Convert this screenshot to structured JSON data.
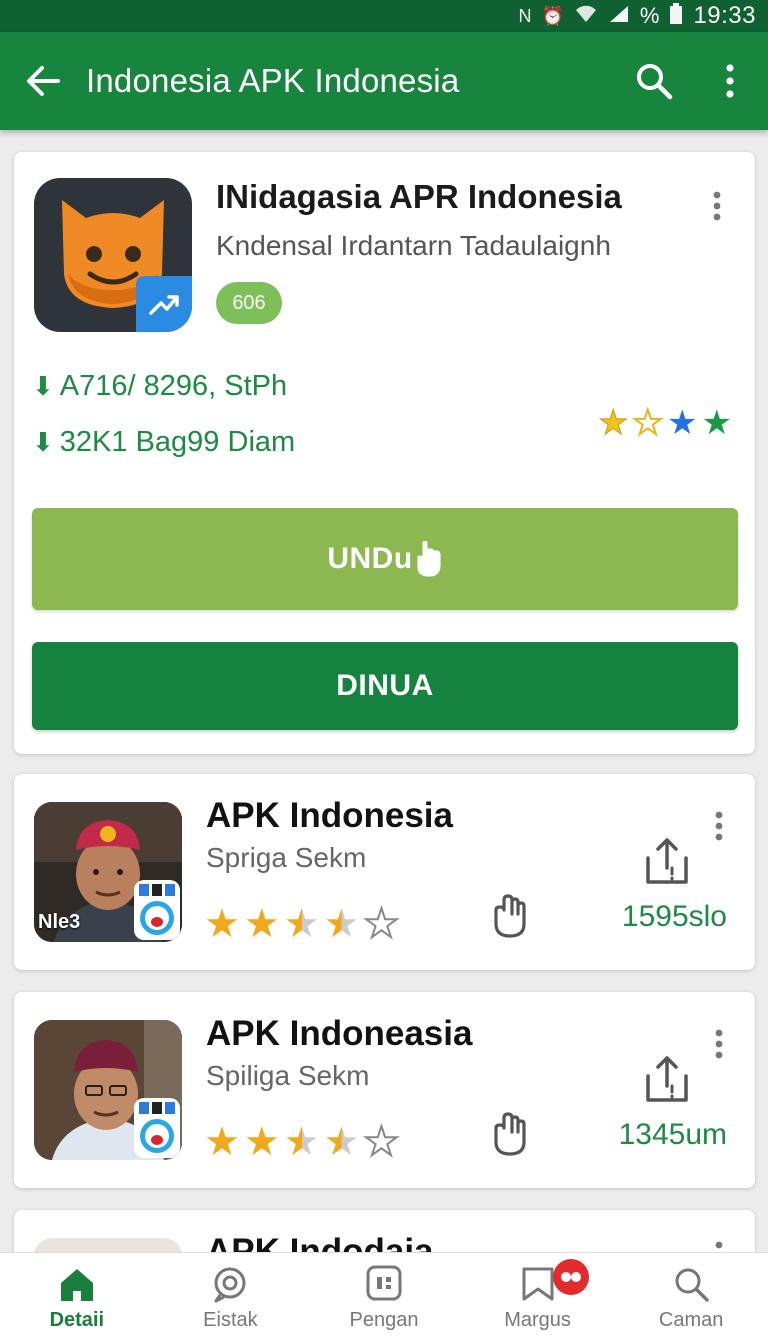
{
  "status_bar": {
    "time": "19:33",
    "battery_text": "%",
    "icons": [
      "nfc-icon",
      "alarm-icon",
      "wifi-icon",
      "signal-icon",
      "battery-icon"
    ]
  },
  "app_bar": {
    "title": "Indonesia  APK Indonesia",
    "icons": [
      "back-arrow-icon",
      "search-icon",
      "more-vert-icon"
    ]
  },
  "main_card": {
    "app_name": "INidagasia APR Indonesia",
    "developer": "Kndensal Irdantarn Tadaulaignh",
    "badge": "606",
    "stat_1": "A716/ 8296, StPh",
    "stat_2": "32K1 Bag99 Diam",
    "rating_stars": [
      "empty-gold",
      "empty-gold",
      "filled-blue",
      "filled-green"
    ],
    "install_button": "UNDu",
    "open_button": "DINUA"
  },
  "list_items": [
    {
      "name": "APK Indonesia",
      "subtitle": "Spriga Sekm",
      "thumb_text": "Nle3",
      "rating": 3.5,
      "size": "1595slo"
    },
    {
      "name": "APK Indoneasia",
      "subtitle": "Spiliga Sekm",
      "thumb_text": "",
      "rating": 3.5,
      "size": "1345um"
    }
  ],
  "peek_item": {
    "name": "APK Indodaia"
  },
  "bottom_nav": [
    {
      "label": "Detaii",
      "icon": "home-icon",
      "active": true
    },
    {
      "label": "Eistak",
      "icon": "chat-icon",
      "active": false
    },
    {
      "label": "Pengan",
      "icon": "apps-icon",
      "active": false
    },
    {
      "label": "Margus",
      "icon": "bookmark-icon",
      "active": false,
      "badge": true
    },
    {
      "label": "Caman",
      "icon": "search-icon",
      "active": false
    }
  ],
  "colors": {
    "status_bar": "#0f6131",
    "app_bar": "#18853f",
    "accent_green": "#1e8a43",
    "install_button": "#8cb852",
    "open_button": "#15823f",
    "star_gold": "#f2a81d"
  }
}
